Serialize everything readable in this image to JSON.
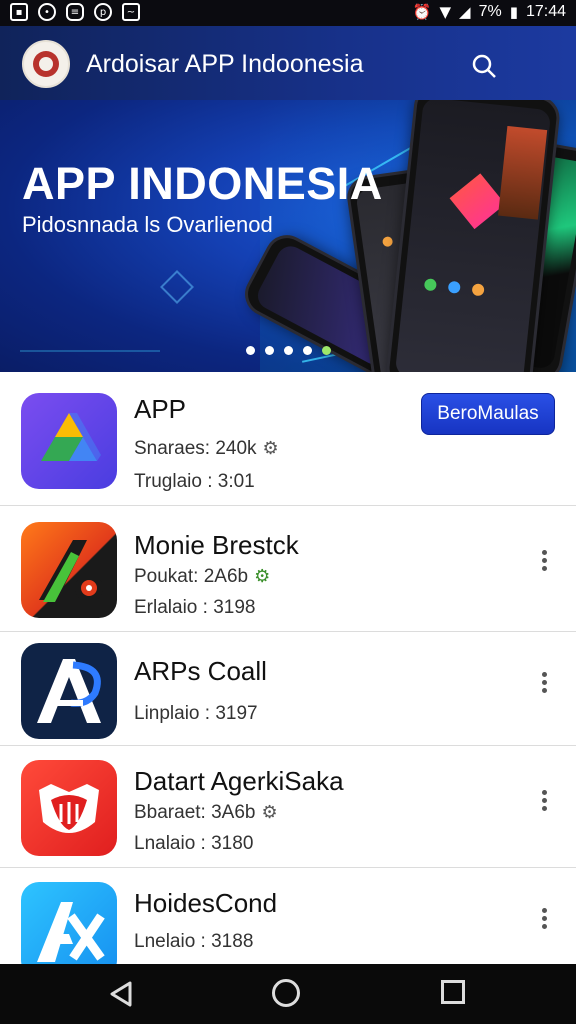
{
  "status_bar": {
    "left_icons": [
      "gallery-icon",
      "chat-icon",
      "message-icon",
      "pinterest-icon",
      "activity-icon"
    ],
    "battery": "7%",
    "time": "17:44"
  },
  "header": {
    "title": "Ardoisar APP Indoonesia"
  },
  "hero": {
    "title": "APP INDONESIA",
    "subtitle": "Pidosnnada ls Ovarlienod",
    "dots": 5,
    "active_dot": 5
  },
  "apps": [
    {
      "name": "APP",
      "meta1": "Snaraes: 240k",
      "meta2": "Truglaio : 3:01",
      "button": "BeroMaulas",
      "icon": "google-drive-style-icon"
    },
    {
      "name": "Monie Brestck",
      "meta1": "Poukat: 2A6b",
      "meta2": "Erlalaio : 3198",
      "icon": "orange-arrow-app-icon"
    },
    {
      "name": "ARPs Coall",
      "meta2": "Linplaio : 3197",
      "icon": "ap-letter-app-icon"
    },
    {
      "name": "Datart AgerkiSaka",
      "meta1": "Bbaraet: 3A6b",
      "meta2": "Lnalaio : 3180",
      "icon": "red-mascot-app-icon"
    },
    {
      "name": "HoidesCond",
      "meta2": "Lnelaio : 3188",
      "icon": "blue-x-app-icon"
    }
  ],
  "colors": {
    "header_bg": "#17318a",
    "hero_bg": "#1440b3",
    "install_button": "#2040d6",
    "active_dot": "#9ee86a"
  }
}
